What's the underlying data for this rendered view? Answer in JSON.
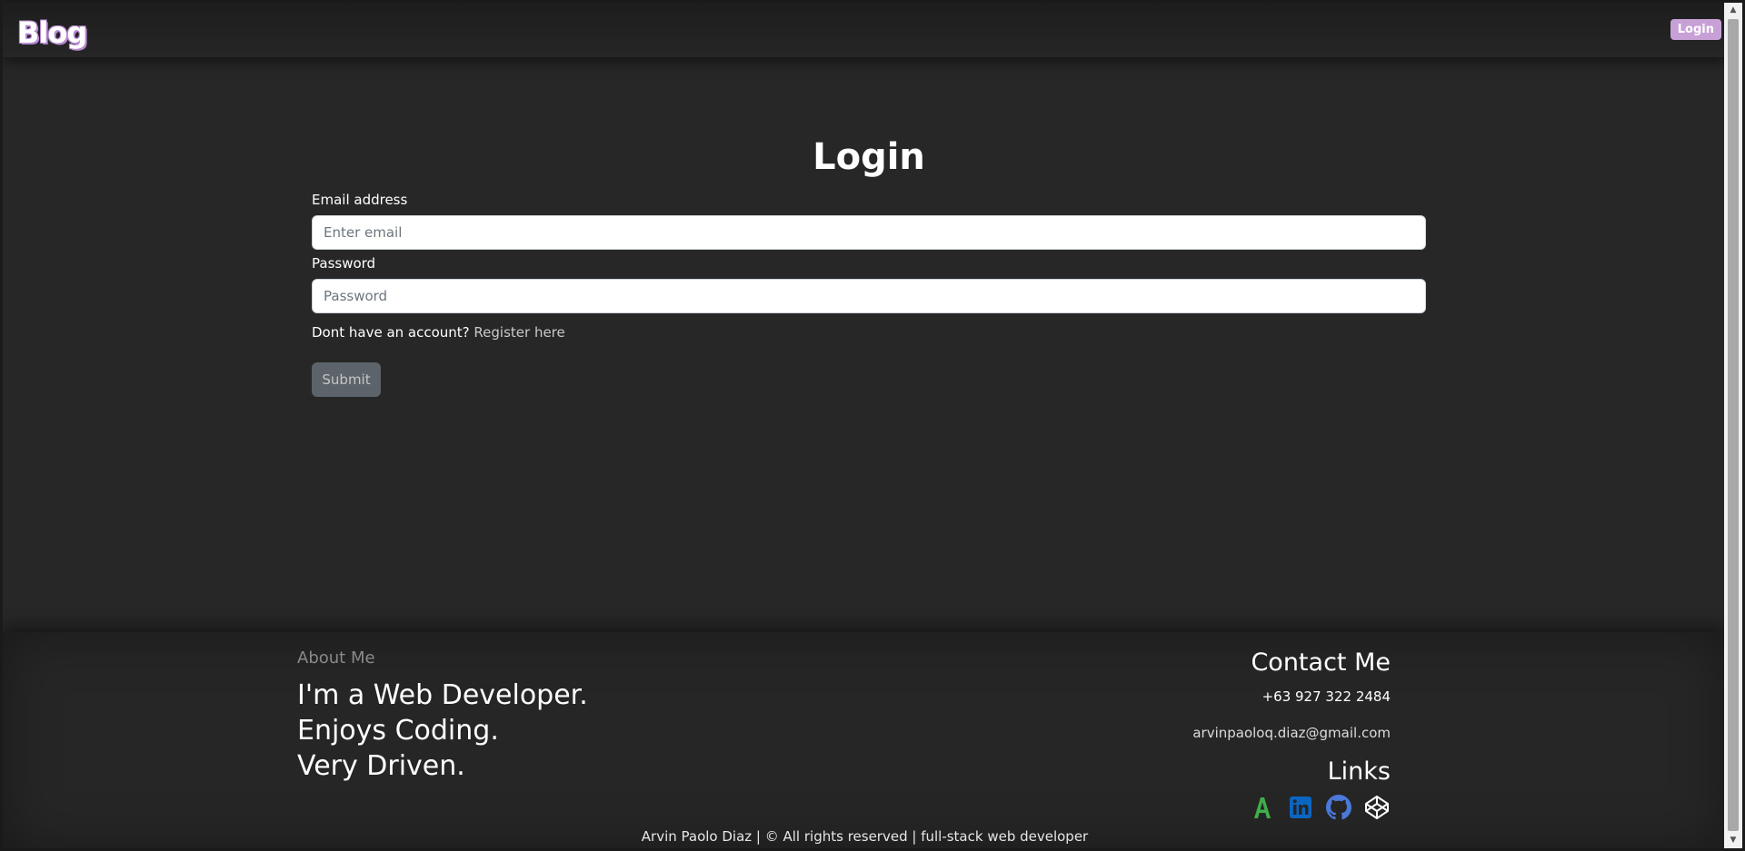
{
  "navbar": {
    "brand": "Blog",
    "login_button": "Login"
  },
  "main": {
    "title": "Login",
    "email_label": "Email address",
    "email_placeholder": "Enter email",
    "password_label": "Password",
    "password_placeholder": "Password",
    "no_account_text": "Dont have an account? ",
    "register_link": "Register here",
    "submit_label": "Submit"
  },
  "footer": {
    "about_heading": "About Me",
    "about_lines": [
      "I'm a Web Developer.",
      "Enjoys Coding.",
      "Very Driven."
    ],
    "contact_heading": "Contact Me",
    "phone": "+63 927 322 2484",
    "email": "arvinpaoloq.diaz@gmail.com",
    "links_heading": "Links",
    "link_icons": [
      "font-a-icon",
      "linkedin-icon",
      "github-icon",
      "codepen-icon"
    ],
    "copyright": "Arvin Paolo Diaz  |  © All rights reserved  |  full-stack web developer"
  },
  "colors": {
    "background": "#272727",
    "accent": "#c7a0d6",
    "linkedin": "#0a66c2",
    "github": "#4a79d9",
    "font_a": "#3fae49"
  }
}
